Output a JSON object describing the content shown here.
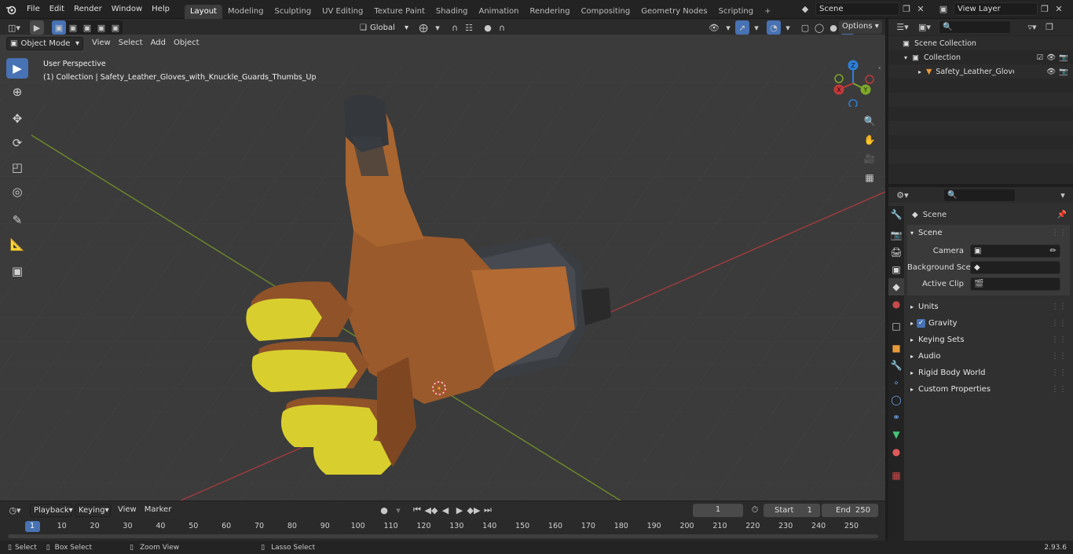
{
  "topbar": {
    "menus": [
      "File",
      "Edit",
      "Render",
      "Window",
      "Help"
    ],
    "workspaces": [
      "Layout",
      "Modeling",
      "Sculpting",
      "UV Editing",
      "Texture Paint",
      "Shading",
      "Animation",
      "Rendering",
      "Compositing",
      "Geometry Nodes",
      "Scripting"
    ],
    "active_workspace": "Layout",
    "add_tab": "+",
    "scene_name": "Scene",
    "view_layer_name": "View Layer"
  },
  "viewport_header": {
    "mode": "Object Mode",
    "menus": [
      "View",
      "Select",
      "Add",
      "Object"
    ],
    "transform_orientation": "Global",
    "options_label": "Options"
  },
  "viewport": {
    "perspective_label": "User Perspective",
    "collection_label": "(1) Collection | Safety_Leather_Gloves_with_Knuckle_Guards_Thumbs_Up",
    "gizmo": {
      "z": "Z",
      "y": "Y",
      "x": "X"
    }
  },
  "outliner": {
    "search_placeholder": "",
    "scene_collection": "Scene Collection",
    "collection": "Collection",
    "object": "Safety_Leather_Gloves_v"
  },
  "properties": {
    "search_placeholder": "",
    "context": "Scene",
    "scene_panel": "Scene",
    "fields": [
      {
        "label": "Camera",
        "value": ""
      },
      {
        "label": "Background Scene",
        "value": ""
      },
      {
        "label": "Active Clip",
        "value": ""
      }
    ],
    "panels": [
      "Units",
      "Gravity",
      "Keying Sets",
      "Audio",
      "Rigid Body World",
      "Custom Properties"
    ]
  },
  "timeline": {
    "menus": [
      "Playback",
      "Keying",
      "View",
      "Marker"
    ],
    "current_frame": "1",
    "start_label": "Start",
    "start_value": "1",
    "end_label": "End",
    "end_value": "250",
    "ruler": [
      "1",
      "10",
      "20",
      "30",
      "40",
      "50",
      "60",
      "70",
      "80",
      "90",
      "100",
      "110",
      "120",
      "130",
      "140",
      "150",
      "160",
      "170",
      "180",
      "190",
      "200",
      "210",
      "220",
      "230",
      "240",
      "250"
    ]
  },
  "statusbar": {
    "select": "Select",
    "box_select": "Box Select",
    "zoom_view": "Zoom View",
    "lasso_select": "Lasso Select",
    "version": "2.93.6"
  },
  "colors": {
    "accent": "#4772b3",
    "x_axis": "#c0393b",
    "y_axis": "#7ea82a",
    "gizmo_z": "#2e7fd6",
    "glove_leather": "#9a5a2c",
    "knuckle_guard": "#d8cf2e"
  }
}
